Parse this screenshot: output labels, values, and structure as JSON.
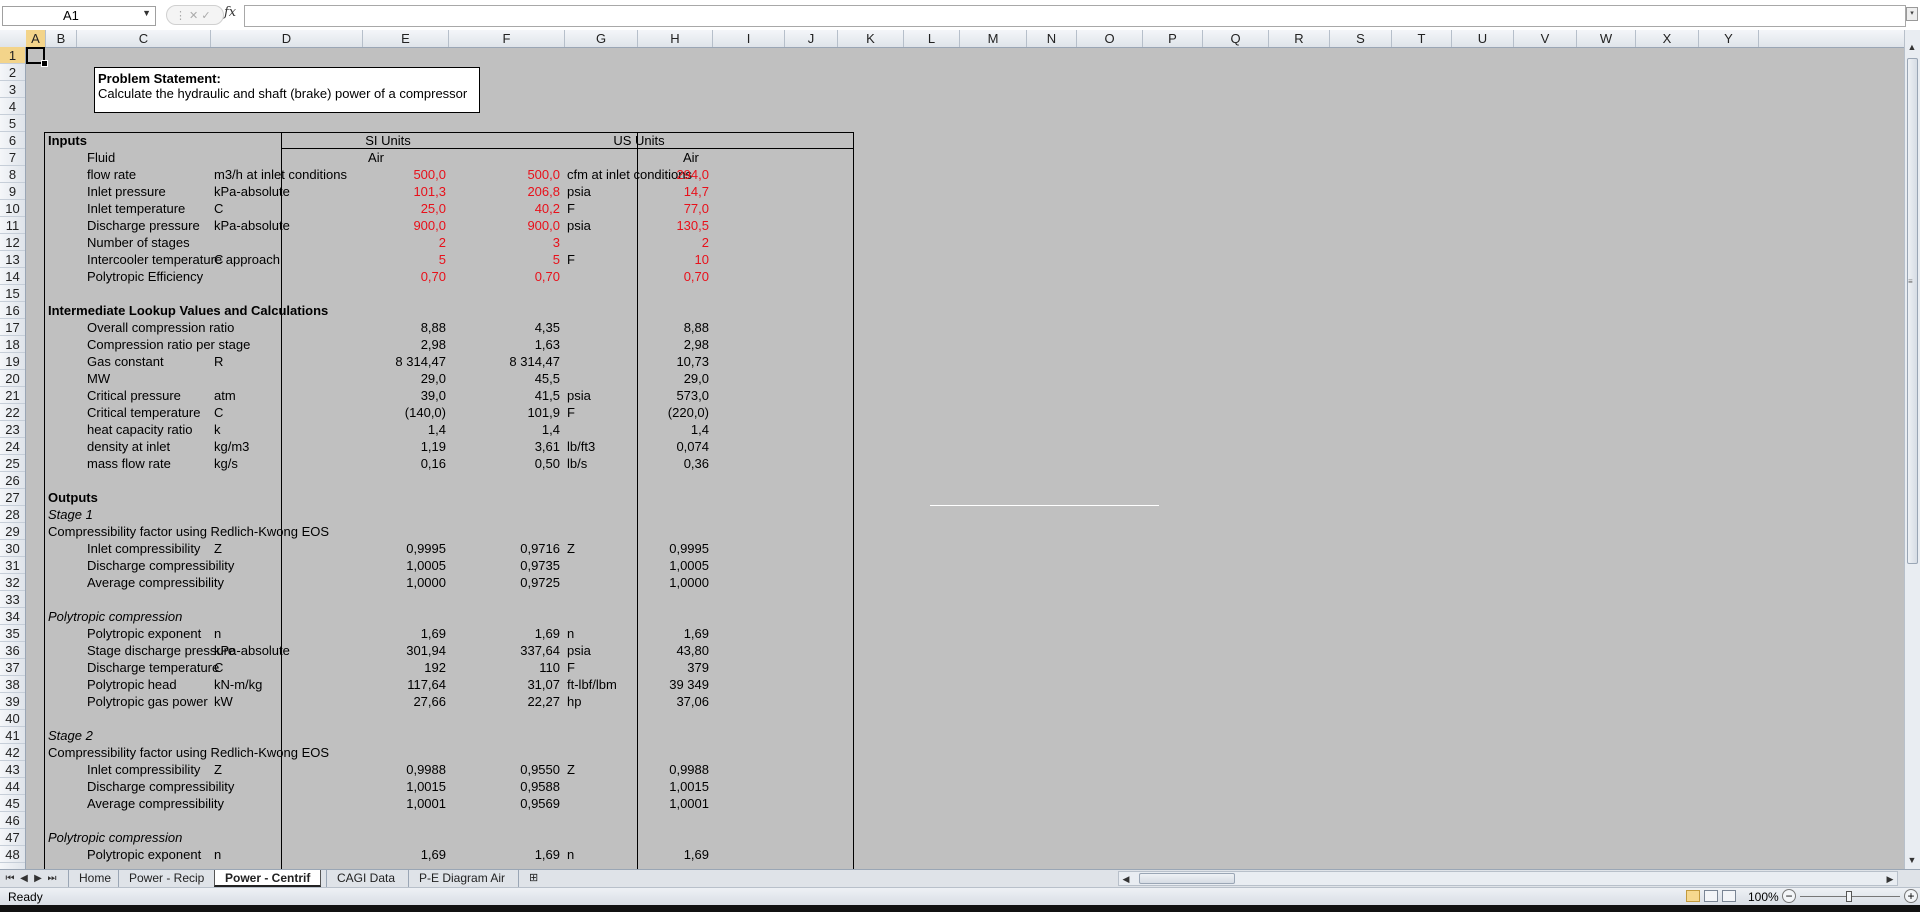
{
  "formula_bar": {
    "name_box": "A1",
    "fx_label": "fx",
    "formula": ""
  },
  "columns": [
    "A",
    "B",
    "C",
    "D",
    "E",
    "F",
    "G",
    "H",
    "I",
    "J",
    "K",
    "L",
    "M",
    "N",
    "O",
    "P",
    "Q",
    "R",
    "S",
    "T",
    "U",
    "V",
    "W",
    "X",
    "Y"
  ],
  "rows": [
    "1",
    "2",
    "3",
    "4",
    "5",
    "6",
    "7",
    "8",
    "9",
    "10",
    "11",
    "12",
    "13",
    "14",
    "15",
    "16",
    "17",
    "18",
    "19",
    "20",
    "21",
    "22",
    "23",
    "24",
    "25",
    "26",
    "27",
    "28",
    "29",
    "30",
    "31",
    "32",
    "33",
    "34",
    "35",
    "36",
    "37",
    "38",
    "39",
    "40",
    "41",
    "42",
    "43",
    "44",
    "45",
    "46",
    "47",
    "48"
  ],
  "textbox": {
    "title": "Problem Statement:",
    "body": "Calculate the hydraulic and shaft (brake) power of a compressor"
  },
  "sheet": {
    "inputs_title": "Inputs",
    "si_header": "SI Units",
    "us_header": "US Units",
    "inputs": [
      {
        "label": "Fluid",
        "unit_si": "",
        "e": "Air",
        "f": "",
        "unit_us": "",
        "h": "Air"
      },
      {
        "label": "flow rate",
        "unit_si": "m3/h at inlet conditions",
        "e": "500,0",
        "f": "500,0",
        "unit_us": "cfm at inlet conditions",
        "h": "294,0"
      },
      {
        "label": "Inlet pressure",
        "unit_si": "kPa-absolute",
        "e": "101,3",
        "f": "206,8",
        "unit_us": "psia",
        "h": "14,7"
      },
      {
        "label": "Inlet temperature",
        "unit_si": "C",
        "e": "25,0",
        "f": "40,2",
        "unit_us": "F",
        "h": "77,0"
      },
      {
        "label": "Discharge pressure",
        "unit_si": "kPa-absolute",
        "e": "900,0",
        "f": "900,0",
        "unit_us": "psia",
        "h": "130,5"
      },
      {
        "label": "Number of stages",
        "unit_si": "",
        "e": "2",
        "f": "3",
        "unit_us": "",
        "h": "2"
      },
      {
        "label": "Intercooler temperature approach",
        "unit_si": "C",
        "e": "5",
        "f": "5",
        "unit_us": "F",
        "h": "10"
      },
      {
        "label": "Polytropic Efficiency",
        "unit_si": "",
        "e": "0,70",
        "f": "0,70",
        "unit_us": "",
        "h": "0,70"
      }
    ],
    "intermediate_title": "Intermediate Lookup Values and Calculations",
    "intermediate": [
      {
        "label": "Overall compression ratio",
        "unit_si": "",
        "e": "8,88",
        "f": "4,35",
        "unit_us": "",
        "h": "8,88"
      },
      {
        "label": "Compression ratio per stage",
        "unit_si": "",
        "e": "2,98",
        "f": "1,63",
        "unit_us": "",
        "h": "2,98"
      },
      {
        "label": "Gas constant",
        "unit_si": "R",
        "e": "8 314,47",
        "f": "8 314,47",
        "unit_us": "",
        "h": "10,73"
      },
      {
        "label": "MW",
        "unit_si": "",
        "e": "29,0",
        "f": "45,5",
        "unit_us": "",
        "h": "29,0"
      },
      {
        "label": "Critical pressure",
        "unit_si": "atm",
        "e": "39,0",
        "f": "41,5",
        "unit_us": "psia",
        "h": "573,0"
      },
      {
        "label": "Critical temperature",
        "unit_si": "C",
        "e": "(140,0)",
        "f": "101,9",
        "unit_us": "F",
        "h": "(220,0)"
      },
      {
        "label": "heat capacity ratio",
        "unit_si": "k",
        "e": "1,4",
        "f": "1,4",
        "unit_us": "",
        "h": "1,4"
      },
      {
        "label": "density at inlet",
        "unit_si": "kg/m3",
        "e": "1,19",
        "f": "3,61",
        "unit_us": "lb/ft3",
        "h": "0,074"
      },
      {
        "label": "mass flow rate",
        "unit_si": "kg/s",
        "e": "0,16",
        "f": "0,50",
        "unit_us": "lb/s",
        "h": "0,36"
      }
    ],
    "outputs_title": "Outputs",
    "stage1_title": "Stage 1",
    "stage2_title": "Stage 2",
    "compress_title": "Compressibility factor using Redlich-Kwong EOS",
    "poly_title": "Polytropic compression",
    "stage1_compress": [
      {
        "label": "Inlet compressibility",
        "unit_si": "Z",
        "e": "0,9995",
        "f": "0,9716",
        "unit_us": "Z",
        "h": "0,9995"
      },
      {
        "label": "Discharge compressibility",
        "unit_si": "",
        "e": "1,0005",
        "f": "0,9735",
        "unit_us": "",
        "h": "1,0005"
      },
      {
        "label": "Average compressibility",
        "unit_si": "",
        "e": "1,0000",
        "f": "0,9725",
        "unit_us": "",
        "h": "1,0000"
      }
    ],
    "stage1_poly": [
      {
        "label": "Polytropic exponent",
        "unit_si": "n",
        "e": "1,69",
        "f": "1,69",
        "unit_us": "n",
        "h": "1,69"
      },
      {
        "label": "Stage discharge pressure",
        "unit_si": "kPa-absolute",
        "e": "301,94",
        "f": "337,64",
        "unit_us": "psia",
        "h": "43,80"
      },
      {
        "label": "Discharge temperature",
        "unit_si": "C",
        "e": "192",
        "f": "110",
        "unit_us": "F",
        "h": "379"
      },
      {
        "label": "Polytropic head",
        "unit_si": "kN-m/kg",
        "e": "117,64",
        "f": "31,07",
        "unit_us": "ft-lbf/lbm",
        "h": "39 349"
      },
      {
        "label": "Polytropic gas power",
        "unit_si": "kW",
        "e": "27,66",
        "f": "22,27",
        "unit_us": "hp",
        "h": "37,06"
      }
    ],
    "stage2_compress": [
      {
        "label": "Inlet compressibility",
        "unit_si": "Z",
        "e": "0,9988",
        "f": "0,9550",
        "unit_us": "Z",
        "h": "0,9988"
      },
      {
        "label": "Discharge compressibility",
        "unit_si": "",
        "e": "1,0015",
        "f": "0,9588",
        "unit_us": "",
        "h": "1,0015"
      },
      {
        "label": "Average compressibility",
        "unit_si": "",
        "e": "1,0001",
        "f": "0,9569",
        "unit_us": "",
        "h": "1,0001"
      }
    ],
    "stage2_poly": [
      {
        "label": "Polytropic exponent",
        "unit_si": "n",
        "e": "1,69",
        "f": "1,69",
        "unit_us": "n",
        "h": "1,69"
      }
    ]
  },
  "tabs": [
    {
      "label": "Home",
      "active": false
    },
    {
      "label": "Power - Recip",
      "active": false
    },
    {
      "label": "Power - Centrif",
      "active": true
    },
    {
      "label": "CAGI Data",
      "active": false
    },
    {
      "label": "P-E Diagram Air",
      "active": false
    }
  ],
  "status": {
    "text": "Ready",
    "zoom": "100%"
  },
  "colors": {
    "input_red": "#e8101a",
    "selection": "#f3d48a"
  },
  "icons": [
    "fx-icon",
    "new-sheet-icon",
    "normal-view-icon",
    "page-layout-icon",
    "page-break-icon",
    "zoom-out-icon",
    "zoom-in-icon"
  ]
}
